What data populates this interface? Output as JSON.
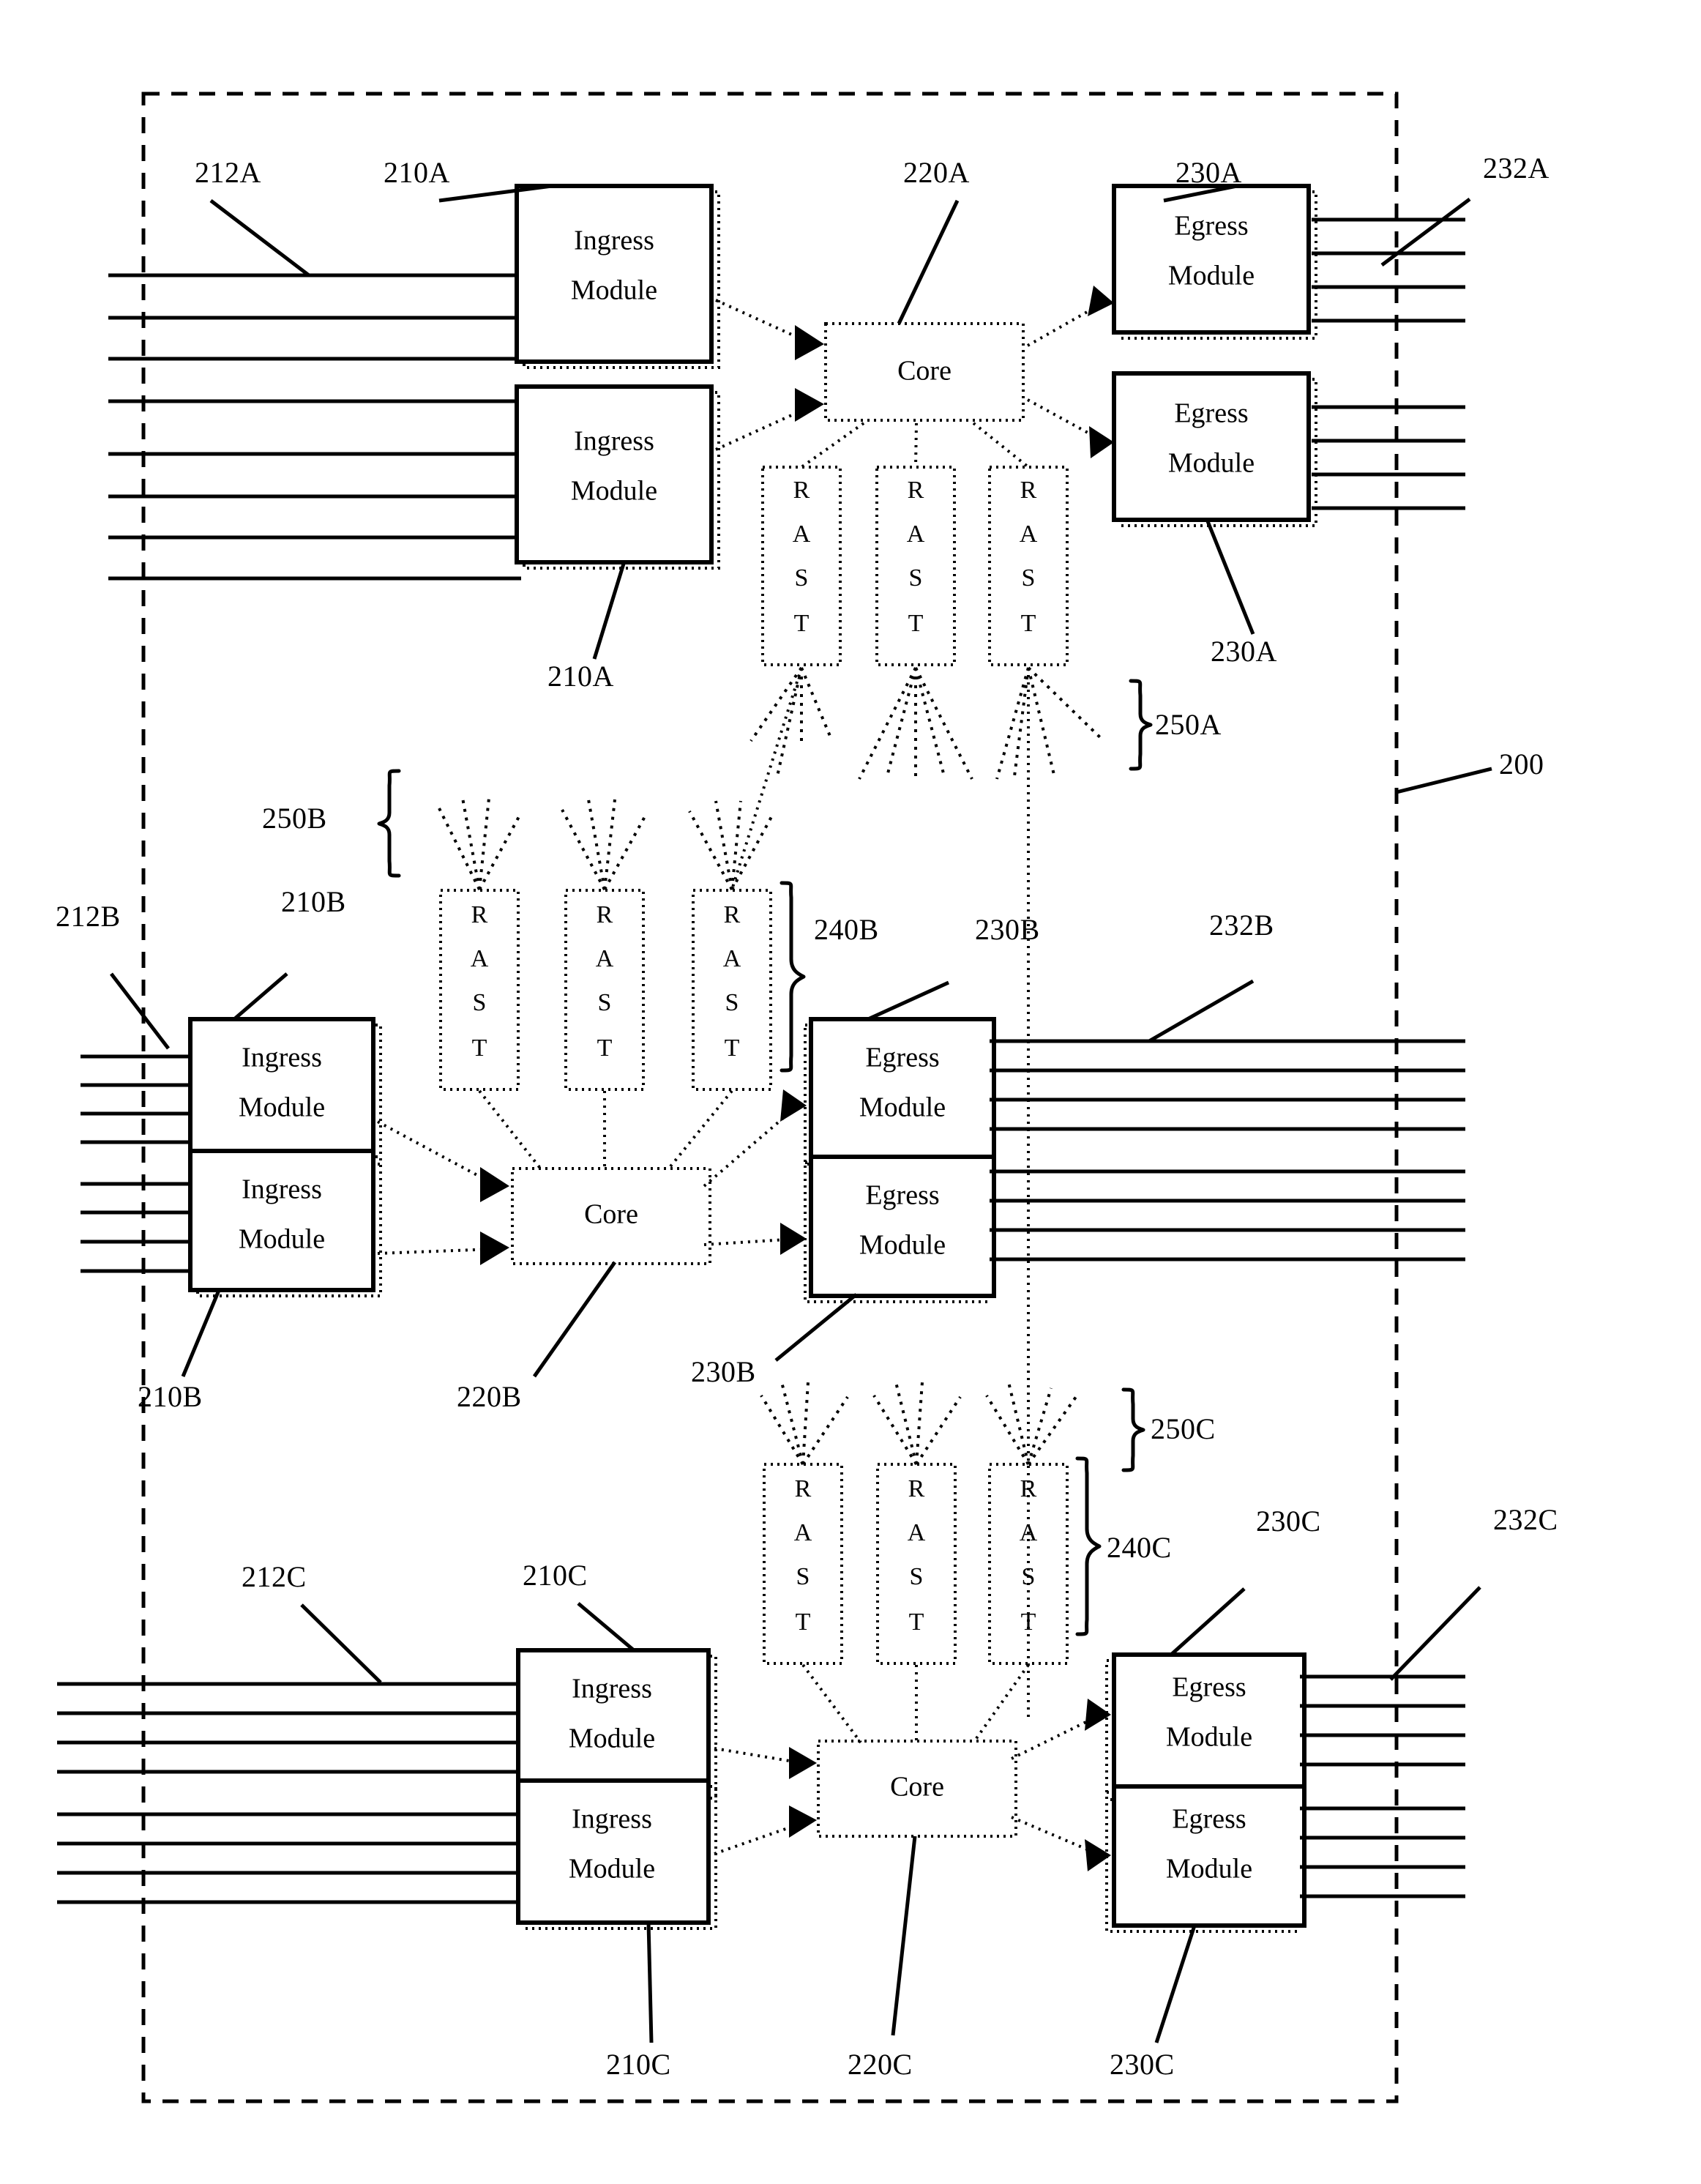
{
  "figure": {
    "system_ref": "200",
    "module_labels": {
      "ingress": "Ingress\nModule",
      "ingress_line1": "Ingress",
      "ingress_line2": "Module",
      "egress_line1": "Egress",
      "egress_line2": "Module",
      "core": "Core",
      "rast_letters": [
        "R",
        "A",
        "S",
        "T"
      ]
    }
  },
  "sections": [
    {
      "id": "A",
      "ingress_ref_top": "212A",
      "ingress_module_ref_top": "210A",
      "ingress_module_ref_bottom": "210A",
      "core_ref": "220A",
      "egress_module_ref_top": "230A",
      "egress_module_ref_bottom": "230A",
      "egress_ref": "232A",
      "rast_group_ref": "250A",
      "ingress_modules": [
        "Ingress Module",
        "Ingress Module"
      ],
      "egress_modules": [
        "Egress Module",
        "Egress Module"
      ],
      "core": "Core",
      "rast_count": 3
    },
    {
      "id": "B",
      "ingress_ref": "212B",
      "ingress_module_ref_top": "210B",
      "ingress_module_ref_bottom": "210B",
      "core_ref": "220B",
      "egress_module_ref_top": "230B",
      "egress_module_ref_bottom": "230B",
      "egress_ref": "232B",
      "rast_group_ref": "240B",
      "rast_fan_ref": "250B",
      "ingress_modules": [
        "Ingress Module",
        "Ingress Module"
      ],
      "egress_modules": [
        "Egress Module",
        "Egress Module"
      ],
      "core": "Core",
      "rast_count": 3
    },
    {
      "id": "C",
      "ingress_ref": "212C",
      "ingress_module_ref_top": "210C",
      "ingress_module_ref_bottom": "210C",
      "core_ref": "220C",
      "egress_module_ref_top": "230C",
      "egress_module_ref_bottom": "230C",
      "egress_ref": "232C",
      "rast_group_ref": "240C",
      "rast_fan_ref": "250C",
      "ingress_modules": [
        "Ingress Module",
        "Ingress Module"
      ],
      "egress_modules": [
        "Egress Module",
        "Egress Module"
      ],
      "core": "Core",
      "rast_count": 3
    }
  ],
  "labels": {
    "l_212A": "212A",
    "l_210A_top": "210A",
    "l_220A": "220A",
    "l_230A_top": "230A",
    "l_232A": "232A",
    "l_210A_bottom": "210A",
    "l_230A_bottom": "230A",
    "l_250A": "250A",
    "l_200": "200",
    "l_250B": "250B",
    "l_212B": "212B",
    "l_210B_top": "210B",
    "l_240B": "240B",
    "l_230B_top": "230B",
    "l_232B": "232B",
    "l_230B_bottom": "230B",
    "l_210B_bottom": "210B",
    "l_220B": "220B",
    "l_250C": "250C",
    "l_230C_top": "230C",
    "l_232C": "232C",
    "l_212C": "212C",
    "l_210C_top": "210C",
    "l_240C": "240C",
    "l_210C_bottom": "210C",
    "l_220C": "220C",
    "l_230C_bottom": "230C"
  },
  "text": {
    "ingress1": "Ingress",
    "ingress2": "Module",
    "egress1": "Egress",
    "egress2": "Module",
    "core": "Core",
    "r": "R",
    "a": "A",
    "s": "S",
    "t": "T"
  },
  "colors": {
    "line": "#000000",
    "background": "#ffffff"
  }
}
